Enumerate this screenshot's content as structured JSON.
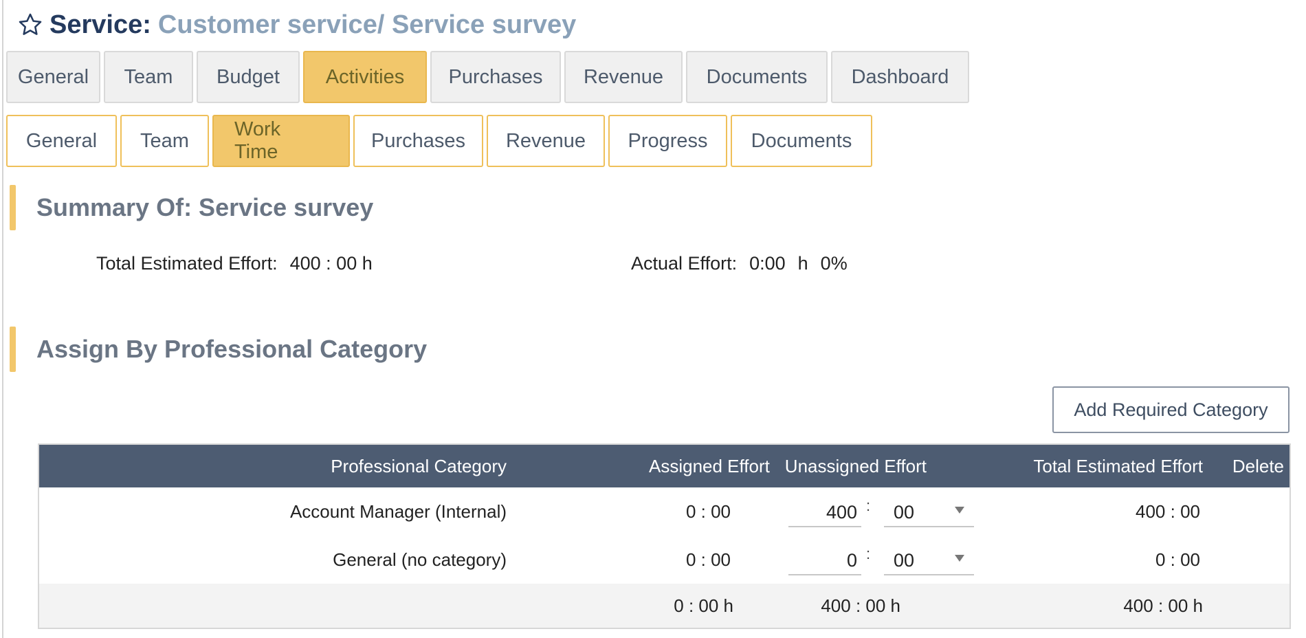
{
  "header": {
    "prefix": "Service:",
    "path": "Customer service/ Service survey"
  },
  "main_tabs": [
    {
      "label": "General",
      "active": false
    },
    {
      "label": "Team",
      "active": false
    },
    {
      "label": "Budget",
      "active": false
    },
    {
      "label": "Activities",
      "active": true
    },
    {
      "label": "Purchases",
      "active": false
    },
    {
      "label": "Revenue",
      "active": false
    },
    {
      "label": "Documents",
      "active": false
    },
    {
      "label": "Dashboard",
      "active": false
    }
  ],
  "sub_tabs": [
    {
      "label": "General",
      "active": false
    },
    {
      "label": "Team",
      "active": false
    },
    {
      "label": "Work Time",
      "active": true
    },
    {
      "label": "Purchases",
      "active": false
    },
    {
      "label": "Revenue",
      "active": false
    },
    {
      "label": "Progress",
      "active": false
    },
    {
      "label": "Documents",
      "active": false
    }
  ],
  "summary": {
    "heading": "Summary Of: Service survey",
    "total_label": "Total Estimated Effort:",
    "total_value": "400 : 00 h",
    "actual_label": "Actual Effort:",
    "actual_value": "0:00",
    "actual_unit": "h",
    "actual_percent": "0%"
  },
  "assign": {
    "heading": "Assign By Professional Category",
    "add_button": "Add Required Category"
  },
  "table": {
    "headers": {
      "category": "Professional Category",
      "assigned": "Assigned Effort",
      "unassigned": "Unassigned Effort",
      "total": "Total Estimated Effort",
      "delete": "Delete"
    },
    "rows": [
      {
        "category": "Account Manager (Internal)",
        "assigned": "0 : 00",
        "unassigned_hours": "400",
        "colon": ":",
        "unassigned_minutes": "00",
        "total": "400 : 00"
      },
      {
        "category": "General (no category)",
        "assigned": "0 : 00",
        "unassigned_hours": "0",
        "colon": ":",
        "unassigned_minutes": "00",
        "total": "0 : 00"
      }
    ],
    "totals": {
      "assigned": "0 : 00 h",
      "unassigned": "400 : 00 h",
      "total": "400 : 00 h"
    }
  },
  "colors": {
    "accent": "#f2c76b",
    "header_bg": "#4d5c72",
    "title_dark": "#243a5e",
    "title_light": "#8aa1b8"
  }
}
